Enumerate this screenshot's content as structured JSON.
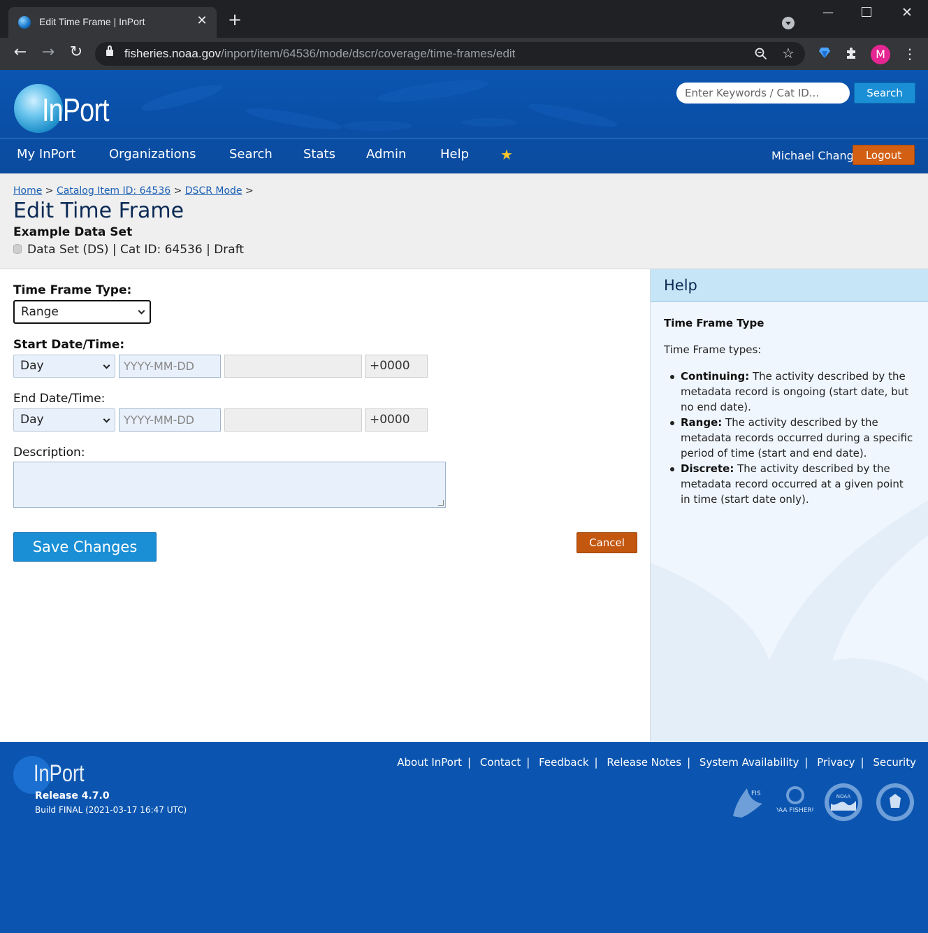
{
  "browser": {
    "tab_title": "Edit Time Frame | InPort",
    "url_host": "fisheries.noaa.gov",
    "url_path": "/inport/item/64536/mode/dscr/coverage/time-frames/edit",
    "avatar_letter": "M"
  },
  "header": {
    "logo_text": "InPort",
    "search_placeholder": "Enter Keywords / Cat ID...",
    "search_button": "Search",
    "nav": [
      "My InPort",
      "Organizations",
      "Search",
      "Stats",
      "Admin",
      "Help"
    ],
    "user_name": "Michael Chang",
    "logout": "Logout"
  },
  "breadcrumb": {
    "home": "Home",
    "catalog": "Catalog Item ID: 64536",
    "mode": "DSCR Mode",
    "sep": ">"
  },
  "page": {
    "title": "Edit Time Frame",
    "item_name": "Example Data Set",
    "item_meta": "Data Set (DS) | Cat ID: 64536 | Draft"
  },
  "form": {
    "type_label": "Time Frame Type:",
    "type_value": "Range",
    "start_label": "Start Date/Time:",
    "end_label": "End Date/Time:",
    "granularity_value": "Day",
    "date_placeholder": "YYYY-MM-DD",
    "timezone_value": "+0000",
    "description_label": "Description:",
    "save_button": "Save Changes",
    "cancel_button": "Cancel"
  },
  "help": {
    "title": "Help",
    "subtitle": "Time Frame Type",
    "intro": "Time Frame types:",
    "items": [
      {
        "term": "Continuing:",
        "text": " The activity described by the metadata record is ongoing (start date, but no end date)."
      },
      {
        "term": "Range:",
        "text": " The activity described by the metadata records occurred during a specific period of time (start and end date)."
      },
      {
        "term": "Discrete:",
        "text": " The activity described by the metadata record occurred at a given point in time (start date only)."
      }
    ]
  },
  "footer": {
    "logo_text": "InPort",
    "release": "Release 4.7.0",
    "build": "Build FINAL (2021-03-17 16:47 UTC)",
    "links": [
      "About InPort",
      "Contact",
      "Feedback",
      "Release Notes",
      "System Availability",
      "Privacy",
      "Security"
    ],
    "seal_fis": "FIS",
    "seal_noaa_fisheries": "NOAA FISHERIES",
    "seal_noaa": "NOAA"
  },
  "colors": {
    "brand_blue": "#0b55b0",
    "accent_button": "#1a8fd6",
    "danger_button": "#c45710"
  }
}
